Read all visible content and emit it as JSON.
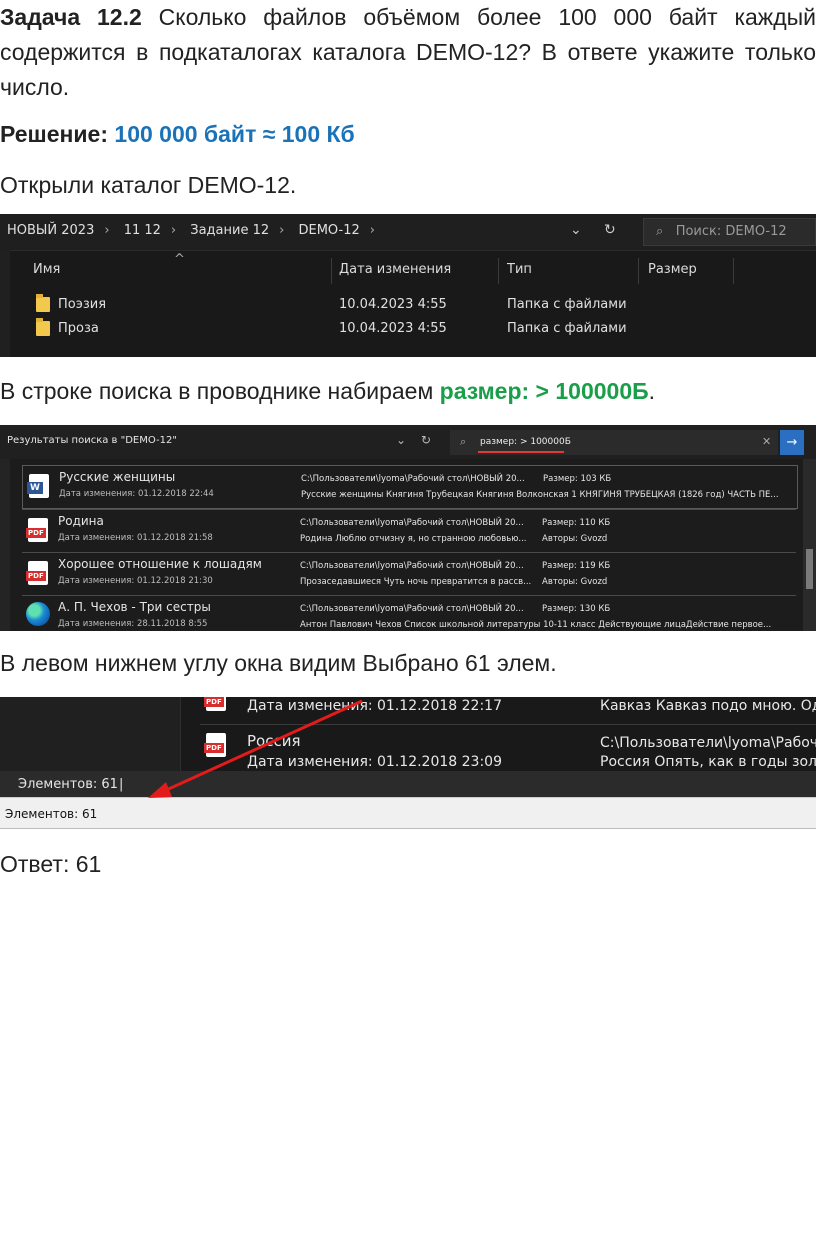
{
  "task": {
    "label": "Задача 12.2",
    "text": " Сколько файлов объёмом более 100 000 байт каждый содержится в подкаталогах каталога DEMO-12? В ответе укажите только число."
  },
  "solution": {
    "label": "Решение:",
    "note": "100 000 байт ≈ 100 Кб"
  },
  "step1": "Открыли каталог DEMO-12.",
  "explorer1": {
    "breadcrumb": [
      "НОВЫЙ 2023",
      "11 12",
      "Задание 12",
      "DEMO-12"
    ],
    "search_placeholder": "Поиск: DEMO-12",
    "columns": [
      "Имя",
      "Дата изменения",
      "Тип",
      "Размер"
    ],
    "rows": [
      {
        "name": "Поэзия",
        "date": "10.04.2023 4:55",
        "type": "Папка с файлами"
      },
      {
        "name": "Проза",
        "date": "10.04.2023 4:55",
        "type": "Папка с файлами"
      }
    ]
  },
  "step2": {
    "before": "В строке поиска в проводнике набираем ",
    "query": "размер: > 100000Б",
    "after": "."
  },
  "explorer2": {
    "title": "Результаты поиска в \"DEMO-12\"",
    "search_value": "размер: > 100000Б",
    "results": [
      {
        "name": "Русские женщины",
        "date": "Дата изменения: 01.12.2018 22:44",
        "path": "C:\\Пользователи\\lyoma\\Рабочий стол\\НОВЫЙ 20...",
        "snippet": "Русские женщины Княгиня Трубецкая Княгиня Волконская 1 КНЯГИНЯ ТРУБЕЦКАЯ (1826 год) ЧАСТЬ ПЕ...",
        "meta1": "Размер: 103 КБ",
        "meta2": "",
        "icon": "word-icon"
      },
      {
        "name": "Родина",
        "date": "Дата изменения: 01.12.2018 21:58",
        "path": "C:\\Пользователи\\lyoma\\Рабочий стол\\НОВЫЙ 20...",
        "snippet": "Родина Люблю отчизну я, но странною любовью...",
        "meta1": "Размер: 110 КБ",
        "meta2": "Авторы: Gvozd",
        "icon": "pdf-icon"
      },
      {
        "name": "Хорошее отношение к лошадям",
        "date": "Дата изменения: 01.12.2018 21:30",
        "path": "C:\\Пользователи\\lyoma\\Рабочий стол\\НОВЫЙ 20...",
        "snippet": "Прозаседавшиеся Чуть ночь превратится в рассв...",
        "meta1": "Размер: 119 КБ",
        "meta2": "Авторы: Gvozd",
        "icon": "pdf-icon"
      },
      {
        "name": "А. П. Чехов - Три сестры",
        "date": "Дата изменения: 28.11.2018 8:55",
        "path": "C:\\Пользователи\\lyoma\\Рабочий стол\\НОВЫЙ 20...",
        "snippet": "Антон Павлович Чехов Список школьной литературы 10-11 класс Действующие лицаДействие первое...",
        "meta1": "Размер: 130 КБ",
        "meta2": "",
        "icon": "edge-icon"
      }
    ]
  },
  "step3": "В левом нижнем углу окна видим Выбрано 61 элем.",
  "explorer3": {
    "row1_date": "Дата изменения: 01.12.2018 22:17",
    "row1_snippet": "Кавказ Кавказ подо мною. Один в",
    "row2_name": "Россия",
    "row2_date": "Дата изменения: 01.12.2018 23:09",
    "row2_path": "C:\\Пользователи\\lyoma\\Рабочий",
    "row2_snippet": "Россия Опять, как в годы золоты",
    "status_dark": "Элементов: 61",
    "status_light": "Элементов: 61",
    "arrow_color": "#e21b1b"
  },
  "answer": "Ответ: 61"
}
